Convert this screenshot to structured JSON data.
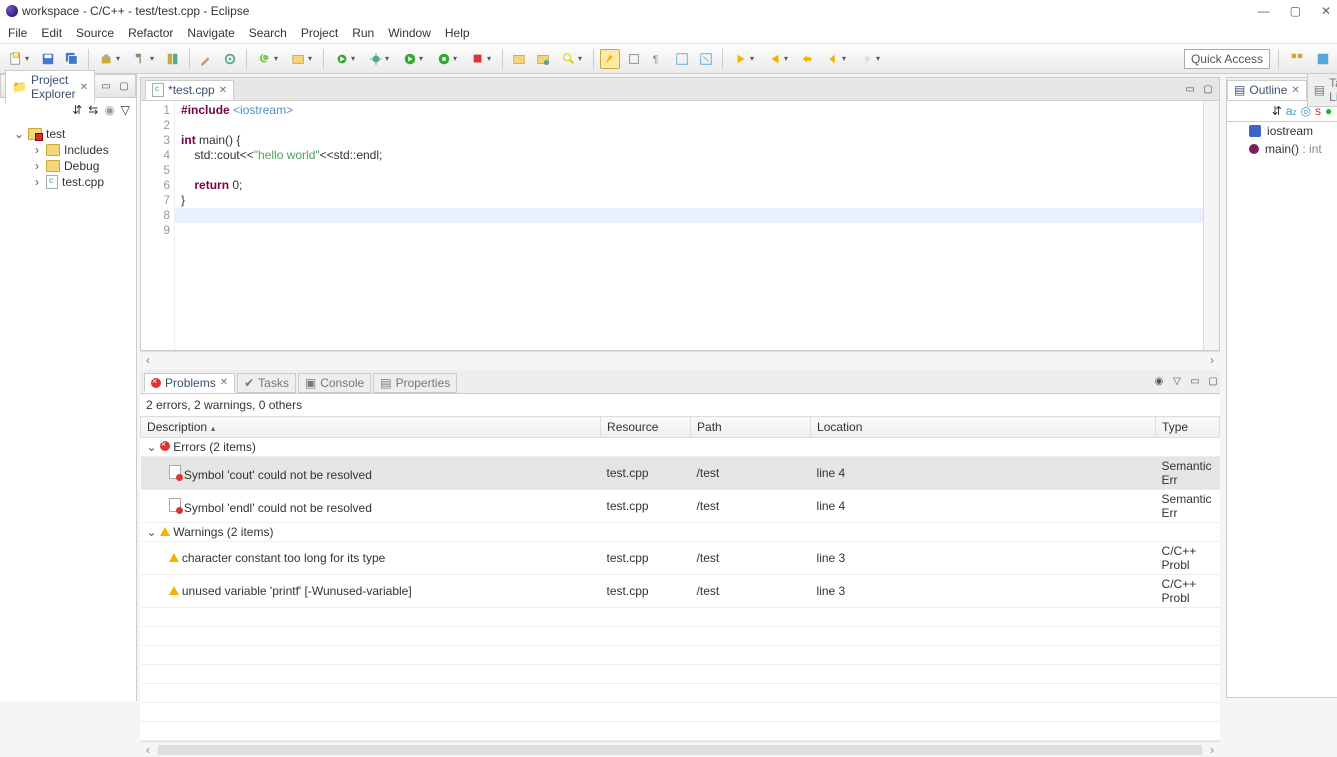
{
  "window": {
    "title": "workspace - C/C++ - test/test.cpp - Eclipse"
  },
  "menu": [
    "File",
    "Edit",
    "Source",
    "Refactor",
    "Navigate",
    "Search",
    "Project",
    "Run",
    "Window",
    "Help"
  ],
  "quick_access": "Quick Access",
  "project_explorer": {
    "title": "Project Explorer",
    "tree": {
      "root": "test",
      "children": [
        {
          "label": "Includes",
          "icon": "includes"
        },
        {
          "label": "Debug",
          "icon": "folder"
        },
        {
          "label": "test.cpp",
          "icon": "cfile"
        }
      ]
    }
  },
  "editor": {
    "tab_label": "*test.cpp",
    "lines": [
      {
        "n": 1
      },
      {
        "n": 2
      },
      {
        "n": 3
      },
      {
        "n": 4
      },
      {
        "n": 5
      },
      {
        "n": 6
      },
      {
        "n": 7
      },
      {
        "n": 8
      },
      {
        "n": 9
      }
    ],
    "code": {
      "l1a": "#include ",
      "l1b": "<iostream>",
      "l3a": "int",
      "l3b": " main() {",
      "l4a": "    std::cout<<",
      "l4b": "\"hello world\"",
      "l4c": "<<std::endl;",
      "l6a": "    ",
      "l6b": "return",
      "l6c": " 0;",
      "l7": "}",
      "l2": "",
      "l5": "",
      "l8": "",
      "l9": ""
    }
  },
  "bottom": {
    "tabs": {
      "problems": "Problems",
      "tasks": "Tasks",
      "console": "Console",
      "properties": "Properties"
    },
    "summary": "2 errors, 2 warnings, 0 others",
    "columns": {
      "description": "Description",
      "resource": "Resource",
      "path": "Path",
      "location": "Location",
      "type": "Type"
    },
    "groups": [
      {
        "label": "Errors (2 items)",
        "kind": "error",
        "items": [
          {
            "desc": "Symbol 'cout' could not be resolved",
            "res": "test.cpp",
            "path": "/test",
            "loc": "line 4",
            "type": "Semantic Err",
            "sel": true
          },
          {
            "desc": "Symbol 'endl' could not be resolved",
            "res": "test.cpp",
            "path": "/test",
            "loc": "line 4",
            "type": "Semantic Err"
          }
        ]
      },
      {
        "label": "Warnings (2 items)",
        "kind": "warning",
        "items": [
          {
            "desc": "character constant too long for its type",
            "res": "test.cpp",
            "path": "/test",
            "loc": "line 3",
            "type": "C/C++ Probl"
          },
          {
            "desc": "unused variable 'printf' [-Wunused-variable]",
            "res": "test.cpp",
            "path": "/test",
            "loc": "line 3",
            "type": "C/C++ Probl"
          }
        ]
      }
    ]
  },
  "outline": {
    "title": "Outline",
    "tasklist": "Task List",
    "items": [
      {
        "label": "iostream",
        "icon": "ios"
      },
      {
        "label": "main()",
        "ret": " : int",
        "icon": "fn"
      }
    ]
  }
}
